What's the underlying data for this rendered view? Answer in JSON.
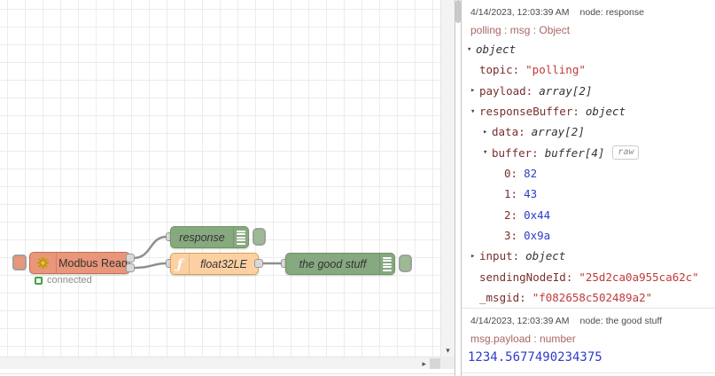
{
  "flow": {
    "nodes": {
      "modbus": {
        "label": "Modbus Read",
        "status": "connected",
        "color": "#e9967a"
      },
      "response": {
        "label": "response",
        "color": "#87a980"
      },
      "function": {
        "label": "float32LE",
        "color": "#fdd0a2"
      },
      "good_stuff": {
        "label": "the good stuff",
        "color": "#87a980"
      }
    },
    "status_green": "#43a047"
  },
  "icons": {
    "function_glyph": "ƒ",
    "modbus_icon": "flower-gear",
    "arrow_down": "▾",
    "arrow_right": "▸"
  },
  "debug": {
    "colors": {
      "key": "#792e2e",
      "string": "#c03a3a",
      "number": "#2e3cc7",
      "meta_path": "#aa6666"
    },
    "messages": [
      {
        "timestamp": "4/14/2023, 12:03:39 AM",
        "node_label": "node: response",
        "path": "polling : msg : Object",
        "tree": [
          {
            "indent": 0,
            "arrow": "down",
            "key": "",
            "value": "object",
            "type": "typename"
          },
          {
            "indent": 1,
            "arrow": "none",
            "key": "topic:",
            "value": "\"polling\"",
            "type": "string"
          },
          {
            "indent": 1,
            "arrow": "right",
            "key": "payload:",
            "value": "array[2]",
            "type": "typename"
          },
          {
            "indent": 1,
            "arrow": "down",
            "key": "responseBuffer:",
            "value": "object",
            "type": "typename"
          },
          {
            "indent": 2,
            "arrow": "right",
            "key": "data:",
            "value": "array[2]",
            "type": "typename"
          },
          {
            "indent": 2,
            "arrow": "down",
            "key": "buffer:",
            "value": "buffer[4]",
            "type": "typename",
            "raw_button": "raw"
          },
          {
            "indent": 3,
            "arrow": "none",
            "key": "0:",
            "value": "82",
            "type": "number"
          },
          {
            "indent": 3,
            "arrow": "none",
            "key": "1:",
            "value": "43",
            "type": "number"
          },
          {
            "indent": 3,
            "arrow": "none",
            "key": "2:",
            "value": "0x44",
            "type": "number"
          },
          {
            "indent": 3,
            "arrow": "none",
            "key": "3:",
            "value": "0x9a",
            "type": "number"
          },
          {
            "indent": 1,
            "arrow": "right",
            "key": "input:",
            "value": "object",
            "type": "typename"
          },
          {
            "indent": 1,
            "arrow": "none",
            "key": "sendingNodeId:",
            "value": "\"25d2ca0a955ca62c\"",
            "type": "string"
          },
          {
            "indent": 1,
            "arrow": "none",
            "key": "_msgid:",
            "value": "\"f082658c502489a2\"",
            "type": "string"
          }
        ]
      },
      {
        "timestamp": "4/14/2023, 12:03:39 AM",
        "node_label": "node: the good stuff",
        "path": "msg.payload : number",
        "value": "1234.5677490234375"
      }
    ]
  }
}
